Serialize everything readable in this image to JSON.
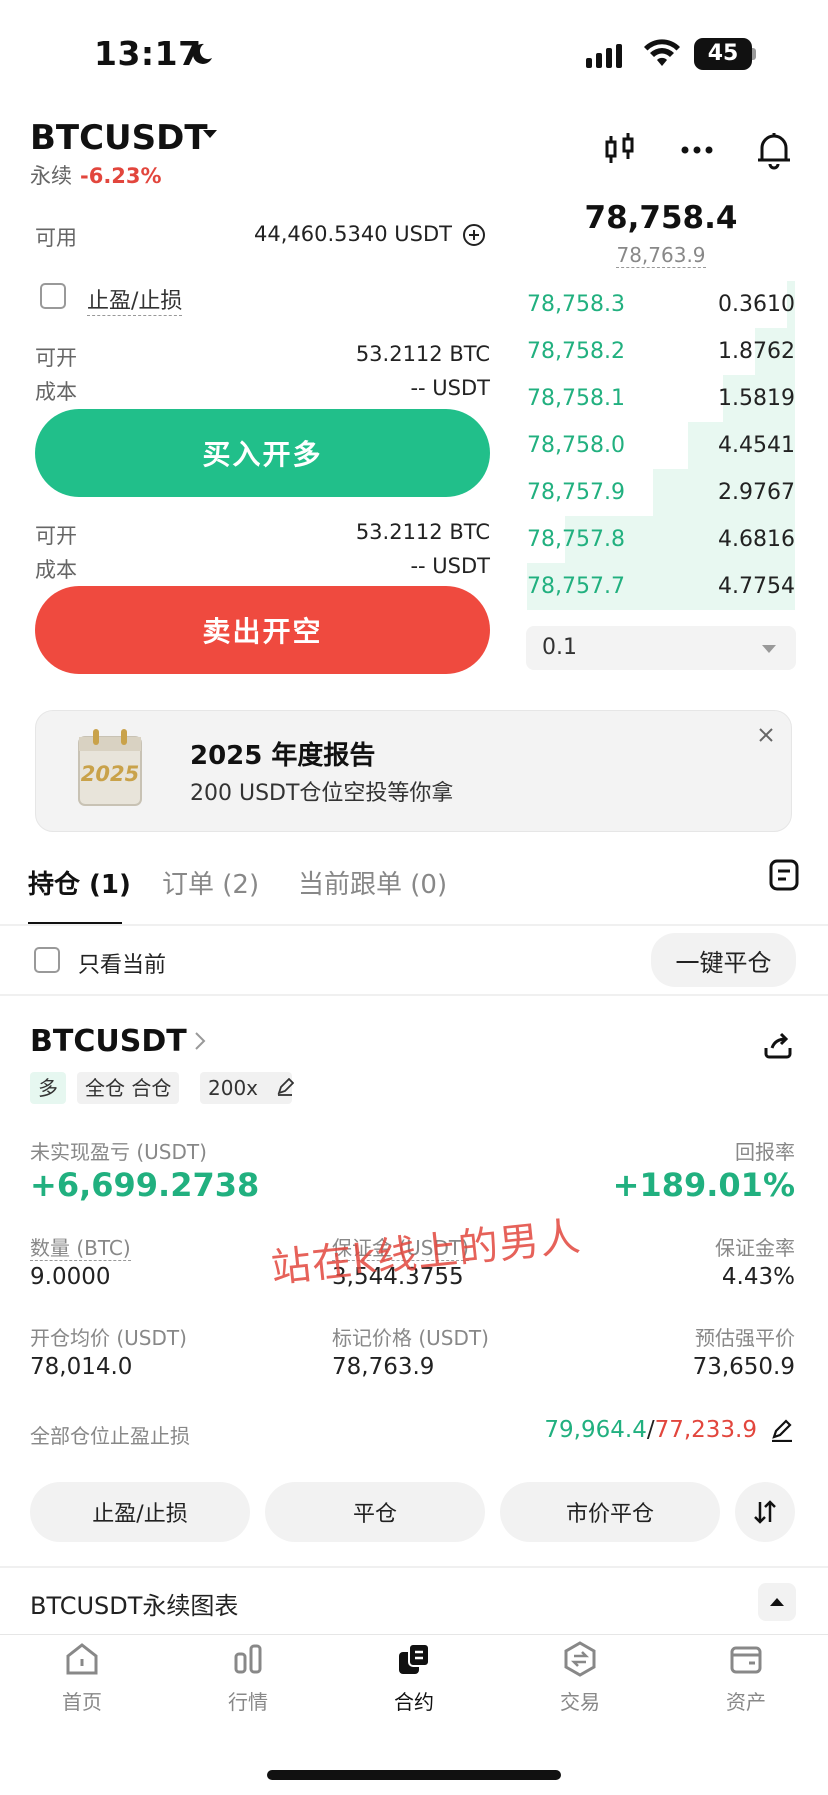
{
  "status_bar": {
    "time": "13:17",
    "battery": "45"
  },
  "header": {
    "symbol": "BTCUSDT",
    "contract_type": "永续",
    "change": "-6.23%"
  },
  "form": {
    "available_label": "可用",
    "available_value": "44,460.5340 USDT",
    "tpsl_label": "止盈/止损",
    "long": {
      "open_label": "可开",
      "open_value": "53.2112 BTC",
      "cost_label": "成本",
      "cost_value": "-- USDT",
      "button": "买入开多"
    },
    "short": {
      "open_label": "可开",
      "open_value": "53.2112 BTC",
      "cost_label": "成本",
      "cost_value": "-- USDT",
      "button": "卖出开空"
    }
  },
  "orderbook": {
    "last_price": "78,758.4",
    "mark_price": "78,763.9",
    "bids": [
      {
        "price": "78,758.3",
        "qty": "0.3610",
        "depth": 0.03
      },
      {
        "price": "78,758.2",
        "qty": "1.8762",
        "depth": 0.15
      },
      {
        "price": "78,758.1",
        "qty": "1.5819",
        "depth": 0.27
      },
      {
        "price": "78,758.0",
        "qty": "4.4541",
        "depth": 0.4
      },
      {
        "price": "78,757.9",
        "qty": "2.9767",
        "depth": 0.53
      },
      {
        "price": "78,757.8",
        "qty": "4.6816",
        "depth": 0.86
      },
      {
        "price": "78,757.7",
        "qty": "4.7754",
        "depth": 1.0
      }
    ],
    "precision": "0.1"
  },
  "banner": {
    "calendar_year": "2025",
    "title": "2025 年度报告",
    "subtitle": "200 USDT仓位空投等你拿"
  },
  "tabs": [
    "持仓 (1)",
    "订单 (2)",
    "当前跟单 (0)"
  ],
  "filter": {
    "only_current": "只看当前",
    "close_all": "一键平仓"
  },
  "position": {
    "symbol": "BTCUSDT",
    "side_tag": "多",
    "margin_tag": "全仓 合仓",
    "leverage_tag": "200x",
    "pnl_label": "未实现盈亏 (USDT)",
    "pnl_value": "+6,699.2738",
    "roe_label": "回报率",
    "roe_value": "+189.01%",
    "qty_label": "数量 (BTC)",
    "qty_value": "9.0000",
    "margin_label": "保证金 (USDT)",
    "margin_value": "3,544.3755",
    "margin_ratio_label": "保证金率",
    "margin_ratio_value": "4.43%",
    "entry_label": "开仓均价 (USDT)",
    "entry_value": "78,014.0",
    "mark_label": "标记价格 (USDT)",
    "mark_value": "78,763.9",
    "liq_label": "预估强平价",
    "liq_value": "73,650.9",
    "tpsl_all_label": "全部仓位止盈止损",
    "tp_value": "79,964.4",
    "sep": "/",
    "sl_value": "77,233.9",
    "buttons": [
      "止盈/止损",
      "平仓",
      "市价平仓"
    ]
  },
  "chart_section": {
    "title": "BTCUSDT永续图表"
  },
  "watermark": "站在k线上的男人",
  "bottom_nav": [
    "首页",
    "行情",
    "合约",
    "交易",
    "资产"
  ]
}
